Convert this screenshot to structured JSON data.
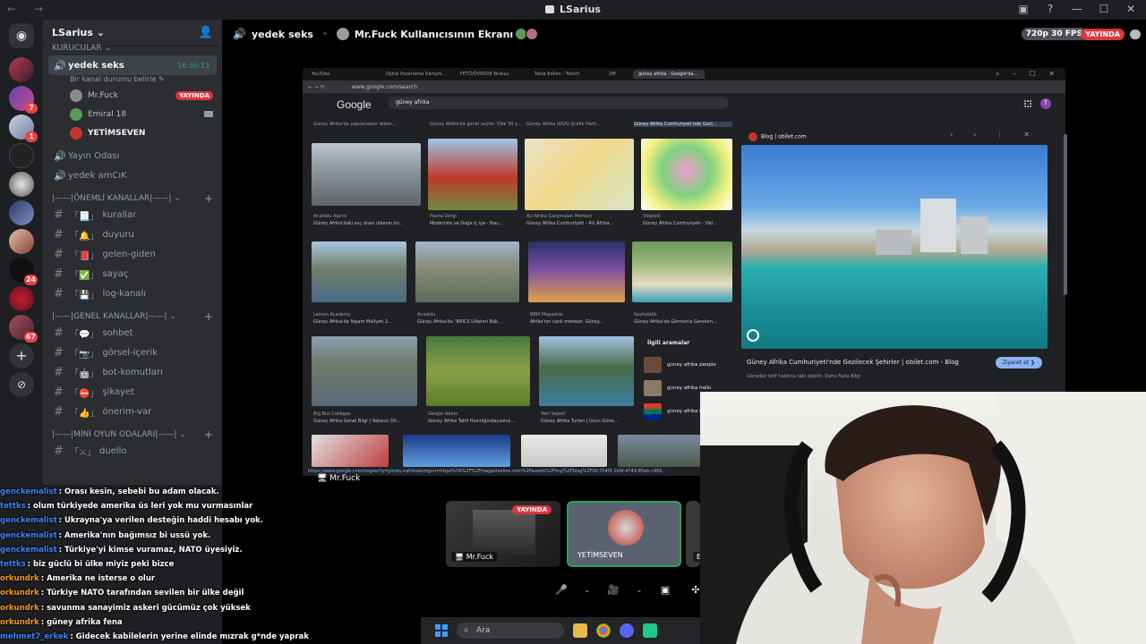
{
  "window": {
    "title": "LSarius",
    "nav": "← →",
    "controls": [
      "▣",
      "?",
      "—",
      "☐",
      "✕"
    ]
  },
  "rail": {
    "badges": [
      "7",
      "1",
      "24",
      "67"
    ]
  },
  "sidebar": {
    "server_name": "LSarius",
    "category_top": "KURUCULAR",
    "active_channel": {
      "name": "yedek seks",
      "time": "16:36:13",
      "status_placeholder": "Bir kanal durumu belirle"
    },
    "voice_users": [
      {
        "name": "Mr.Fuck",
        "badge": "YAYINDA"
      },
      {
        "name": "Emiral 18"
      },
      {
        "name": "YETİMSEVEN"
      }
    ],
    "voice_channels": [
      "Yayın Odası",
      "yedek amCıK"
    ],
    "cat_important": "|——|ÖNEMLİ KANALLAR|——|",
    "important": [
      {
        "icon": "📃",
        "name": "kurallar"
      },
      {
        "icon": "🔔",
        "name": "duyuru"
      },
      {
        "icon": "📕",
        "name": "gelen-giden"
      },
      {
        "icon": "✅",
        "name": "sayaç"
      },
      {
        "icon": "💾",
        "name": "log-kanalı"
      }
    ],
    "cat_general": "|——|GENEL KANALLAR|——|",
    "general": [
      {
        "icon": "💬",
        "name": "sohbet"
      },
      {
        "icon": "📷",
        "name": "görsel-içerik"
      },
      {
        "icon": "🤖",
        "name": "bot-komutları"
      },
      {
        "icon": "⛔",
        "name": "şikayet"
      },
      {
        "icon": "👍",
        "name": "önerim-var"
      }
    ],
    "cat_games": "|——|MİNİ OYUN ODALARI|——|",
    "games": [
      {
        "icon": "⚔",
        "name": "duello"
      }
    ]
  },
  "topbar": {
    "channel": "yedek seks",
    "screen_title": "Mr.Fuck Kullanıcısının Ekranı",
    "quality": "720p 30 FPS",
    "live": "YAYINDA"
  },
  "browser": {
    "tabs": [
      "YouTube",
      "Dijital Pazarlama Danışm...",
      "FETÖ/ÖVERDE Niveau",
      "Takip Edilen - Twitch",
      "ZM",
      "güney afrika - Google'da..."
    ],
    "url": "www.google.com/search",
    "search_query": "güney afrika",
    "logo": "Google",
    "avatar_letter": "T",
    "captions": [
      {
        "src": "Anadolu Ajansı",
        "title": "Güney Afrika'daki suç oranı ülkenin im..."
      },
      {
        "src": "Pasha Dergi",
        "title": "Modernite ve Doğa iç içe - Pau..."
      },
      {
        "src": "AÜ Afrika Çalışmaları Merkezi",
        "title": "Güney Afrika Cumhuriyeti - AÜ Afrika..."
      },
      {
        "src": "Vikipedi",
        "title": "Güney Afrika Cumhuriyeti - Viki..."
      },
      {
        "src": "Lemon Academy",
        "title": "Güney Afrika'da Yaşam Maliyeti 2..."
      },
      {
        "src": "Anadolu",
        "title": "Güney Afrika'da \"BRICS Ülkeleri Bak..."
      },
      {
        "src": "BBM Magazine",
        "title": "Afrika'nın canlı merkezi: Güney..."
      },
      {
        "src": "Keşfedelik",
        "title": "Güney Afrika'da Görmeniz Gereken..."
      },
      {
        "src": "Big Bus Colleges",
        "title": "Güney Afrika Genel Bilgi | Yabancı Dil..."
      },
      {
        "src": "Gezgin Adam",
        "title": "Güney Afrika Tatili Hazırlığındaysanız..."
      },
      {
        "src": "Tatil Sepeti",
        "title": "Güney Afrika Turları | Uzun Güne..."
      }
    ],
    "top_captions": [
      "Güney Afrika'da yapılacaklar listesi...",
      "Güney Afrika'da genel seçim: Ülke 30 y...",
      "Güney Afrika (RSA) Grafik Harit...",
      "Güney Afrika Cumhuriyeti'nde Gezi..."
    ],
    "related": {
      "heading": "İlgili aramalar",
      "items": [
        "güney afrika people",
        "güney afrika halkı",
        "güney afrika b..."
      ]
    },
    "preview": {
      "source": "Blog | obilet.com",
      "title": "Güney Afrika Cumhuriyeti'nde Gezilecek Şehirler | obilet.com - Blog",
      "note": "Görseller telif hakkına tabi olabilir. Daha Fazla Bilgi",
      "visit": "Ziyaret et ❯"
    },
    "status_url": "https://www.google.com/imgres?q=güney+afrika&imgurl=https%3A%2F%2Fmagazinelion.com%2Fassets%2Fimg%2Fblog%2F0fc704f3-1b9f-4749-85eb-c969..."
  },
  "stream": {
    "host_label": "Mr.Fuck",
    "tiles": [
      {
        "name": "Mr.Fuck",
        "live": "YAYINDA"
      },
      {
        "name": "YETİMSEVEN"
      },
      {
        "name": "E"
      }
    ]
  },
  "chat": [
    {
      "user": "genckemalist",
      "color": "#3b82f6",
      "text": ": Orası kesin, sebebi bu adam olacak."
    },
    {
      "user": "tettks",
      "color": "#3b82f6",
      "text": ": olum türkiyede amerika üs leri yok mu vurmasınlar"
    },
    {
      "user": "genckemalist",
      "color": "#3b82f6",
      "text": ": Ukrayna'ya verilen desteğin haddi hesabı yok."
    },
    {
      "user": "genckemalist",
      "color": "#3b82f6",
      "text": ": Amerika'nın bağımsız bi ussü yok."
    },
    {
      "user": "genckemalist",
      "color": "#3b82f6",
      "text": ": Türkiye'yi kimse vuramaz, NATO üyesiyiz."
    },
    {
      "user": "tettks",
      "color": "#3b82f6",
      "text": ": biz güclü bi ülke miyiz peki bizce"
    },
    {
      "user": "orkundrk",
      "color": "#f39c12",
      "text": ": Amerika ne isterse o olur"
    },
    {
      "user": "orkundrk",
      "color": "#f39c12",
      "text": ": Türkiye NATO tarafından sevilen bir ülke değil"
    },
    {
      "user": "orkundrk",
      "color": "#f39c12",
      "text": ": savunma sanayimiz askeri gücümüz çok yüksek"
    },
    {
      "user": "orkundrk",
      "color": "#f39c12",
      "text": ": güney afrika fena"
    },
    {
      "user": "mehmet7_erkek",
      "color": "#3b82f6",
      "text": ": Gidecek kabilelerin yerine elinde mızrak g*nde yaprak"
    }
  ],
  "winbar": {
    "search": "Ara"
  },
  "colors": {
    "live_red": "#da373c",
    "online_green": "#23a55a",
    "blurple": "#5865f2"
  }
}
